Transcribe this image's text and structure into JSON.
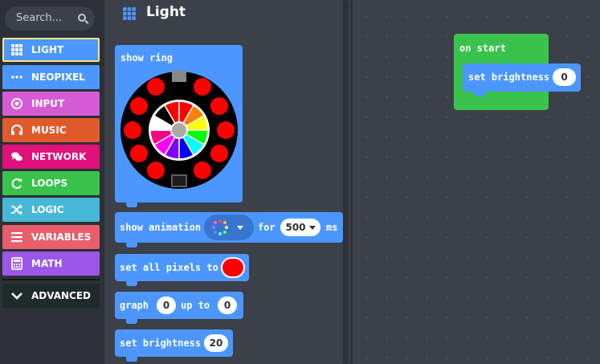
{
  "sidebar": {
    "search_placeholder": "Search...",
    "categories": [
      {
        "label": "LIGHT",
        "color": "#4c97ff",
        "icon": "grid-icon"
      },
      {
        "label": "NEOPIXEL",
        "color": "#4c97ff",
        "icon": "dots-icon"
      },
      {
        "label": "INPUT",
        "color": "#d65cd6",
        "icon": "radio-icon"
      },
      {
        "label": "MUSIC",
        "color": "#e15a2c",
        "icon": "headphones-icon"
      },
      {
        "label": "NETWORK",
        "color": "#e0117a",
        "icon": "chat-icon"
      },
      {
        "label": "LOOPS",
        "color": "#3ac34c",
        "icon": "refresh-icon"
      },
      {
        "label": "LOGIC",
        "color": "#46b8d5",
        "icon": "shuffle-icon"
      },
      {
        "label": "VARIABLES",
        "color": "#e85e6d",
        "icon": "lines-icon"
      },
      {
        "label": "MATH",
        "color": "#9d57e8",
        "icon": "calculator-icon"
      }
    ],
    "advanced_label": "ADVANCED"
  },
  "flyout": {
    "title": "Light",
    "blocks": {
      "show_ring": {
        "label": "show ring"
      },
      "show_animation": {
        "label": "show animation",
        "for_label": "for",
        "duration": "500",
        "unit": "ms"
      },
      "set_all_pixels": {
        "label": "set all pixels to",
        "color": "#ff0000"
      },
      "graph": {
        "label": "graph",
        "value": "0",
        "up_to_label": "up to",
        "max": "0"
      },
      "set_brightness": {
        "label": "set brightness",
        "value": "20"
      }
    }
  },
  "workspace": {
    "on_start": {
      "label": "on start"
    },
    "set_brightness": {
      "label": "set brightness",
      "value": "0"
    }
  },
  "colors": {
    "light_block": "#4c97ff",
    "on_start_block": "#3ac34c",
    "ring_red": "#ff0000"
  }
}
